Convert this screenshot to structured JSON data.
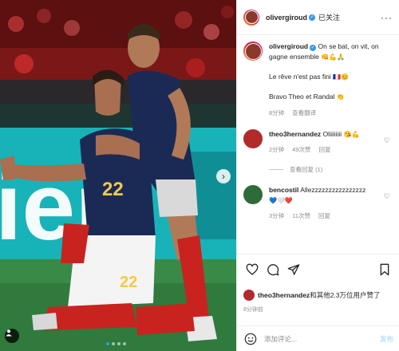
{
  "post": {
    "username": "olivergiroud",
    "follow_label": "已关注",
    "more_label": "···"
  },
  "caption": {
    "username": "olivergiroud",
    "line1": "On se bat, on vit, on gagne ensemble",
    "line1_emoji": "👊💪🙏",
    "line2": "Le rêve n'est pas fini",
    "line2_emoji": "🇫🇷😊",
    "line3": "Bravo Theo et Randal",
    "line3_emoji": "👏",
    "time": "8分钟",
    "translate_label": "查看翻译"
  },
  "comments": [
    {
      "username": "theo3hernandez",
      "text": "Oliiiiiiii",
      "emoji": "😘💪",
      "emoji2": "💪",
      "time": "2分钟",
      "likes": "49次赞",
      "reply_label": "回复",
      "view_replies": "查看回复 (1)"
    },
    {
      "username": "bencostil",
      "text": "Allezzzzzzzzzzzzzzzz",
      "emoji": "💙🤍❤️",
      "time": "3分钟",
      "likes": "11次赞",
      "reply_label": "回复"
    }
  ],
  "likes_line": {
    "username": "theo3hernandez",
    "text": "和其他2.3万位用户赞了"
  },
  "post_time": "8分钟前",
  "add_comment": {
    "placeholder": "添加评论...",
    "post_label": "发布"
  },
  "photo": {
    "jersey_number_back": "22",
    "jersey_number_shorts": "22"
  },
  "colors": {
    "verified": "#3897f0",
    "jersey": "#1b2a55",
    "socks": "#c9231f",
    "pitch": "#2f7a3c",
    "ad_board": "#18b3b8"
  }
}
